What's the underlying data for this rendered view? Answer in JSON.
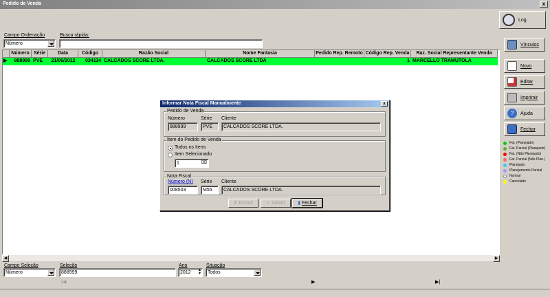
{
  "window": {
    "title": "Pedido de Venda",
    "close": "x"
  },
  "top": {
    "order_label": "Campo Ordenação",
    "order_value": "Número",
    "search_label": "Busca rápida:",
    "search_value": ""
  },
  "grid": {
    "columns": [
      "Número",
      "Série",
      "Data",
      "Código",
      "Razão Social",
      "Nome Fantasia",
      "Pedido Rep. Remoto",
      "Código Rep. Venda",
      "Raz. Social Representante Venda"
    ],
    "row": {
      "indicator": "▶",
      "numero": "888999",
      "serie": "PVE",
      "data": "21/06/2012",
      "codigo": "034114",
      "razao": "CALCADOS SCORE LTDA.",
      "fantasia": "CALCADOS SCORE LTDA",
      "remoto": "",
      "cod_rep": "1",
      "rep": "MARCELLO TRAMUTOLA"
    },
    "row_color": "#00ff33"
  },
  "buttons": {
    "log": "Log",
    "vinculos": "Vínculos",
    "novo": "Novo",
    "editar": "Editar",
    "imprimir": "Imprimir",
    "ajuda": "Ajuda",
    "fechar": "Fechar"
  },
  "legend": [
    {
      "label": "Fat. (Planejado)",
      "color": "#00cc00"
    },
    {
      "label": "Fat. Parcial (Planejado)",
      "color": "#66aa33"
    },
    {
      "label": "Fat. (Não Planejado)",
      "color": "#ff0000"
    },
    {
      "label": "Fat. Parcial (Não Plan.)",
      "color": "#ff6666"
    },
    {
      "label": "Planejado",
      "color": "#33ccff"
    },
    {
      "label": "Planejamento Parcial",
      "color": "#9999ff"
    },
    {
      "label": "Normal",
      "color": "#ffffff"
    },
    {
      "label": "Cancelado",
      "color": "#ffff00"
    }
  ],
  "dialog": {
    "title": "Informar Nota Fiscal Manualmente",
    "close": "x",
    "pedido_group": "Pedido de Venda",
    "numero_label": "Número",
    "serie_label": "Série",
    "cliente_label": "Cliente",
    "numero": "888999",
    "serie": "PVE",
    "cliente": "CALCADOS SCORE LTDA.",
    "item_group": "Item do Pedido de Venda",
    "todos": "Todos os Itens",
    "selecionado": "Item Selecionado",
    "item_value": "1",
    "nf_group": "Nota Fiscal",
    "nf_numero_label": "Número (N)",
    "nf_serie_label": "Série",
    "nf_cliente_label": "Cliente",
    "nf_numero": "008503",
    "nf_serie": "M55",
    "nf_cliente": "CALCADOS SCORE LTDA.",
    "btn_excluir": "Excluir",
    "btn_salvar": "Salvar",
    "btn_fechar": "Fechar"
  },
  "bottom": {
    "campo_label": "Campo Seleção",
    "campo_value": "Número",
    "selecao_label": "Seleção",
    "selecao_value": "888999",
    "ano_label": "Ano",
    "ano_value": "2012",
    "situacao_label": "Situação",
    "situacao_value": "Todos"
  },
  "nav": {
    "first": "|◀",
    "play": "▶",
    "last": "▶|"
  }
}
